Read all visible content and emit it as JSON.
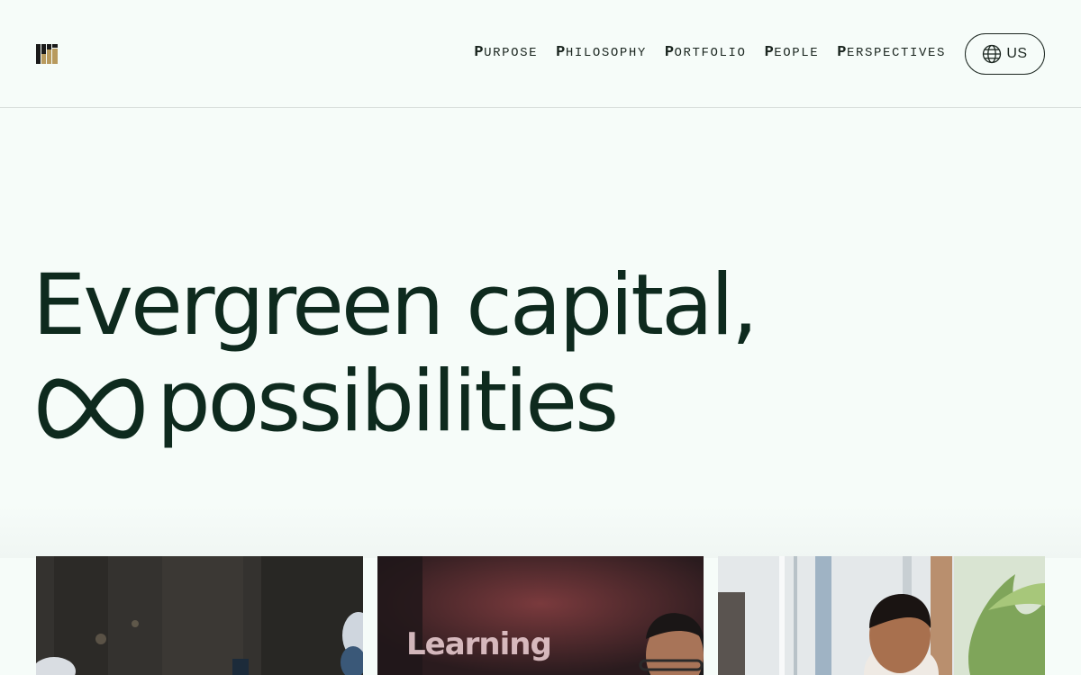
{
  "brand": {
    "logo_icon": "bar-logo-icon",
    "colors": {
      "logo_dark": "#1a1a1a",
      "logo_gold": "#b89a5e",
      "heading": "#0e2a1e",
      "background": "#f6fcf9"
    }
  },
  "nav": {
    "items": [
      {
        "initial": "P",
        "rest": "URPOSE"
      },
      {
        "initial": "P",
        "rest": "HILOSOPHY"
      },
      {
        "initial": "P",
        "rest": "ORTFOLIO"
      },
      {
        "initial": "P",
        "rest": "EOPLE"
      },
      {
        "initial": "P",
        "rest": "ERSPECTIVES"
      }
    ]
  },
  "region": {
    "icon": "globe-icon",
    "label": "US"
  },
  "hero": {
    "line1": "Evergreen capital,",
    "line2_icon": "infinity-icon",
    "line2": "possibilities"
  },
  "cards": [
    {
      "name": "photo-workshop",
      "caption": ""
    },
    {
      "name": "photo-event",
      "caption": "Learning"
    },
    {
      "name": "photo-office",
      "caption": ""
    }
  ]
}
